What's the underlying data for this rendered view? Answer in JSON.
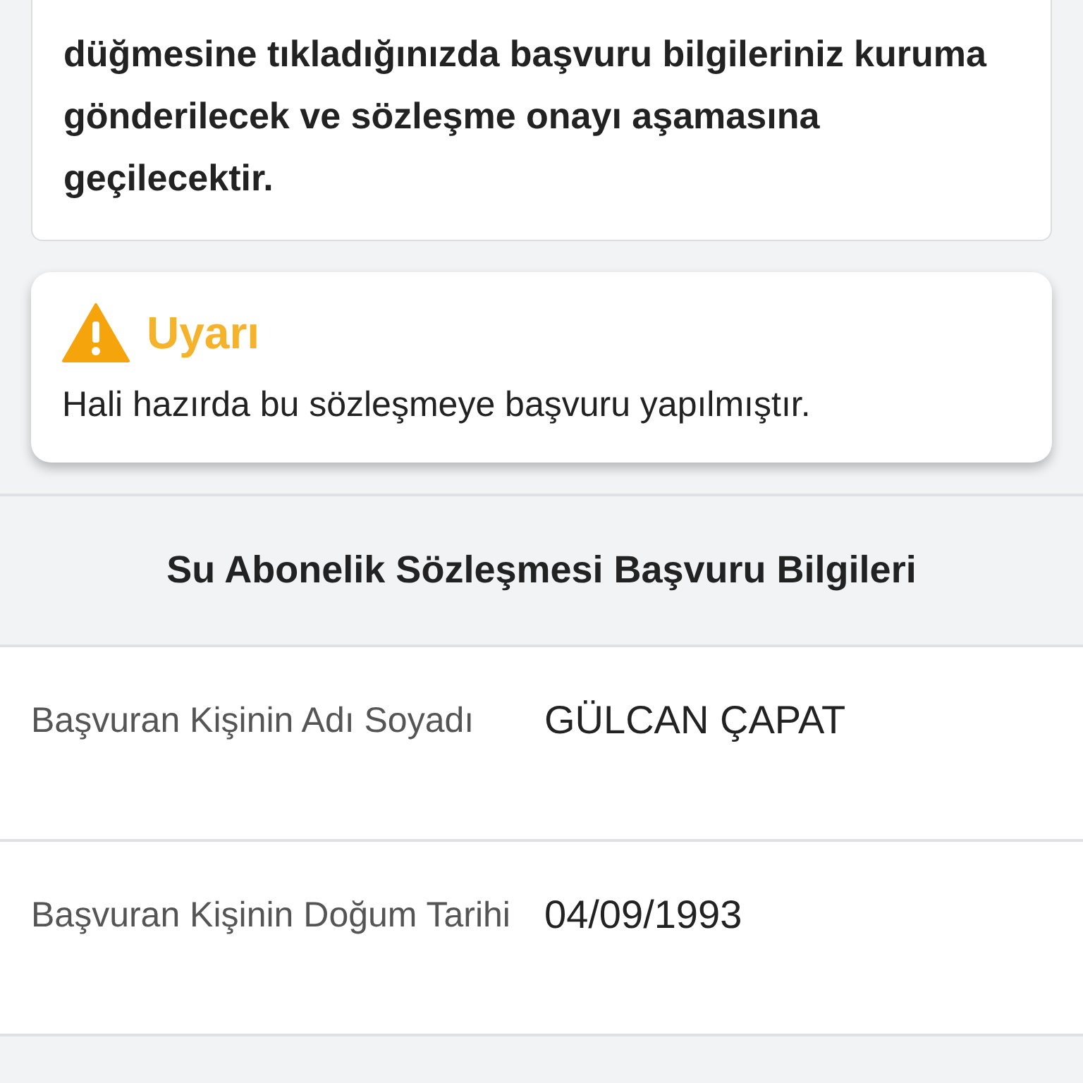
{
  "info_card": {
    "text": "düğmesine tıkladığınızda başvuru bilgileriniz kuruma gönderilecek ve sözleşme onayı aşamasına geçilecektir."
  },
  "warning": {
    "title": "Uyarı",
    "message": "Hali hazırda bu sözleşmeye başvuru yapılmıştır."
  },
  "section": {
    "title": "Su Abonelik Sözleşmesi Başvuru Bilgileri",
    "rows": [
      {
        "label": "Başvuran Kişinin Adı Soyadı",
        "value": "GÜLCAN ÇAPAT"
      },
      {
        "label": "Başvuran Kişinin Doğum Tarihi",
        "value": "04/09/1993"
      }
    ]
  }
}
